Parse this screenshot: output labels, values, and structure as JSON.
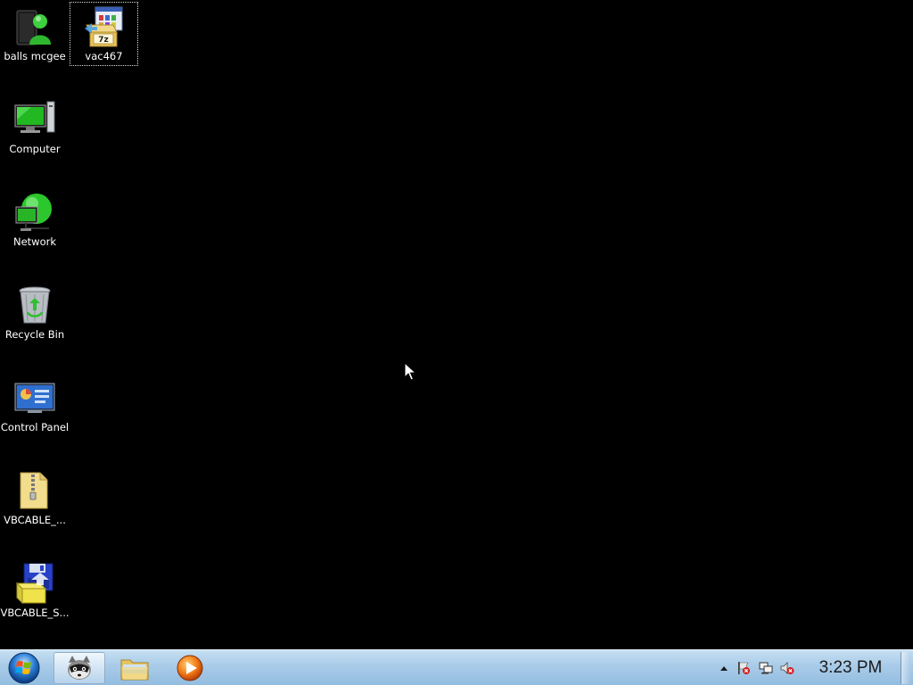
{
  "desktop": {
    "background_color": "#000000",
    "icons": [
      {
        "label": "balls mcgee",
        "icon": "user-folder-icon"
      },
      {
        "label": "vac467",
        "icon": "7zip-archive-icon"
      },
      {
        "label": "Computer",
        "icon": "computer-icon"
      },
      {
        "label": "Network",
        "icon": "network-icon"
      },
      {
        "label": "Recycle Bin",
        "icon": "recycle-bin-icon"
      },
      {
        "label": "Control Panel",
        "icon": "control-panel-icon"
      },
      {
        "label": "VBCABLE_...",
        "icon": "zip-folder-icon"
      },
      {
        "label": "VBCABLE_S...",
        "icon": "setup-installer-icon"
      }
    ]
  },
  "taskbar": {
    "start_icon": "windows-start-orb-icon",
    "pinned": [
      {
        "name": "raccoon-app",
        "icon": "raccoon-icon",
        "active": true
      },
      {
        "name": "windows-explorer",
        "icon": "folder-icon",
        "active": false
      },
      {
        "name": "media-player",
        "icon": "play-icon",
        "active": false
      }
    ],
    "tray": [
      {
        "name": "show-hidden-icons",
        "icon": "chevron-up-icon"
      },
      {
        "name": "action-center",
        "icon": "flag-icon"
      },
      {
        "name": "network-status",
        "icon": "network-tray-icon"
      },
      {
        "name": "volume",
        "icon": "speaker-muted-icon"
      }
    ],
    "clock": "3:23 PM"
  }
}
